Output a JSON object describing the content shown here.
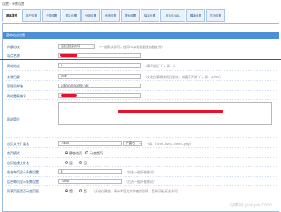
{
  "breadcrumb": "设置 - 参数设置",
  "tabs": [
    "基本属性",
    "用户设置",
    "文件设置",
    "图片设置",
    "分组设置",
    "系统设置",
    "搜索设置",
    "保存设置",
    "FTP/EMAIL",
    "模版设置",
    "显示设置"
  ],
  "panel_title": "基本站点设置",
  "rows": {
    "mode": {
      "label": "伸展协议",
      "value": "直接直接访问",
      "hint": "（一般默认即可，使用http或需要服务器支持）"
    },
    "site_name": {
      "label": "站点名称"
    },
    "site_url": {
      "label": "网站地址",
      "value": "/",
      "hint": "（填写顺后“/”，如：/）"
    },
    "install_dir": {
      "label": "安装目录",
      "value": "/fst/",
      "hint": "（安装目录请按根目录计，如填写开始“/”，如：/cfhs/）"
    },
    "admin_email": {
      "label": "管理员邮箱",
      "value": "admin@name.net"
    },
    "icp": {
      "label": "网站备案编号"
    },
    "intro": {
      "label": "网站简介"
    },
    "ext": {
      "label": "首页文件扩展名",
      "value": ".html",
      "select": "扩展名",
      "hint": "（如：.html,.htm,.shtml,.php）"
    },
    "home_static": {
      "label": "首页模式",
      "options": [
        "静态首页",
        "动态首页"
      ],
      "selected": 0
    },
    "page_static": {
      "label": "首页链接文件名",
      "options": [
        "是",
        "否"
      ],
      "selected": 1
    },
    "list_count": {
      "label": "前台每页显示条数设置",
      "value": "8",
      "hint": "（前台一般不能修改）"
    },
    "search_count": {
      "label": "后台每页显示条数设置",
      "value": "1000",
      "hint": "（后台一般不能修改）"
    },
    "dynamic": {
      "label": "列表页面是否动态页面",
      "options": [
        "是",
        "否"
      ],
      "selected": 0,
      "hint": "（开启伪静态，请参考官方文件使用说明，否则可能无法访问）"
    }
  },
  "watermark": "月季网 yuejiw.com"
}
